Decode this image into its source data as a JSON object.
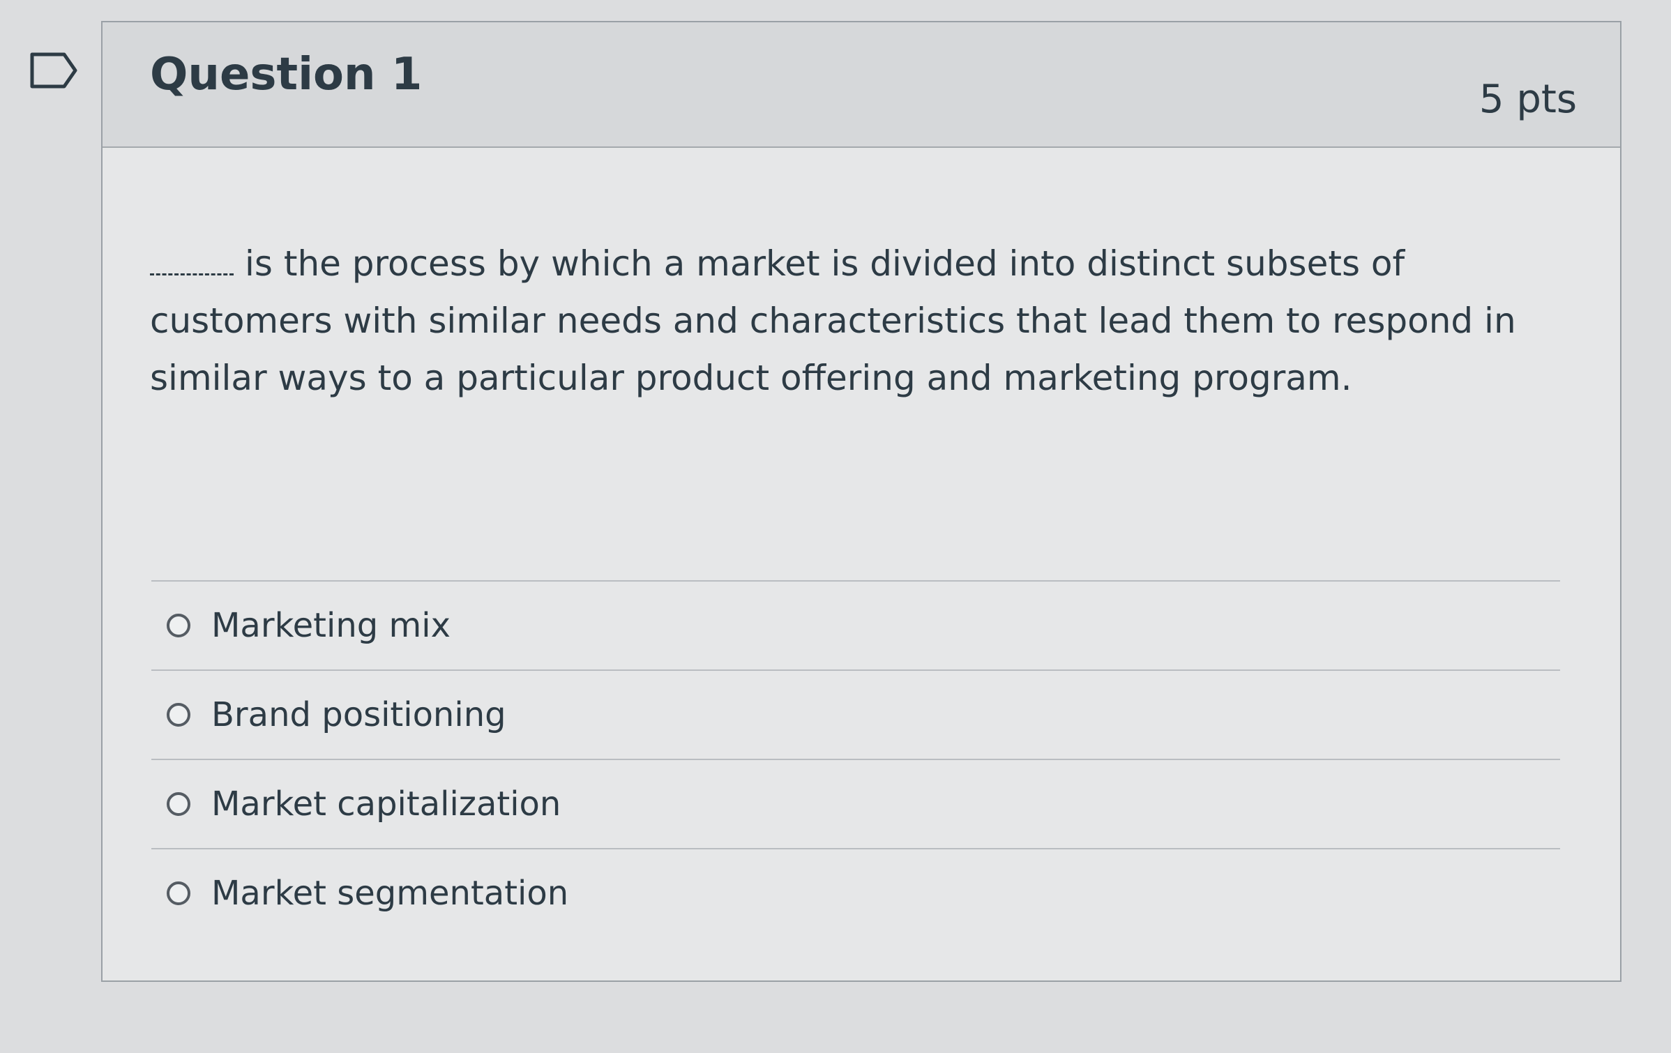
{
  "question": {
    "title": "Question 1",
    "points": "5 pts",
    "text": "is the process by which a market is divided into distinct subsets of customers with similar needs and characteristics that lead them to respond in similar ways to a particular product offering and marketing program."
  },
  "answers": [
    {
      "label": "Marketing mix"
    },
    {
      "label": "Brand positioning"
    },
    {
      "label": "Market capitalization"
    },
    {
      "label": "Market segmentation"
    }
  ],
  "icons": {
    "bookmark": "bookmark-flag-icon"
  }
}
